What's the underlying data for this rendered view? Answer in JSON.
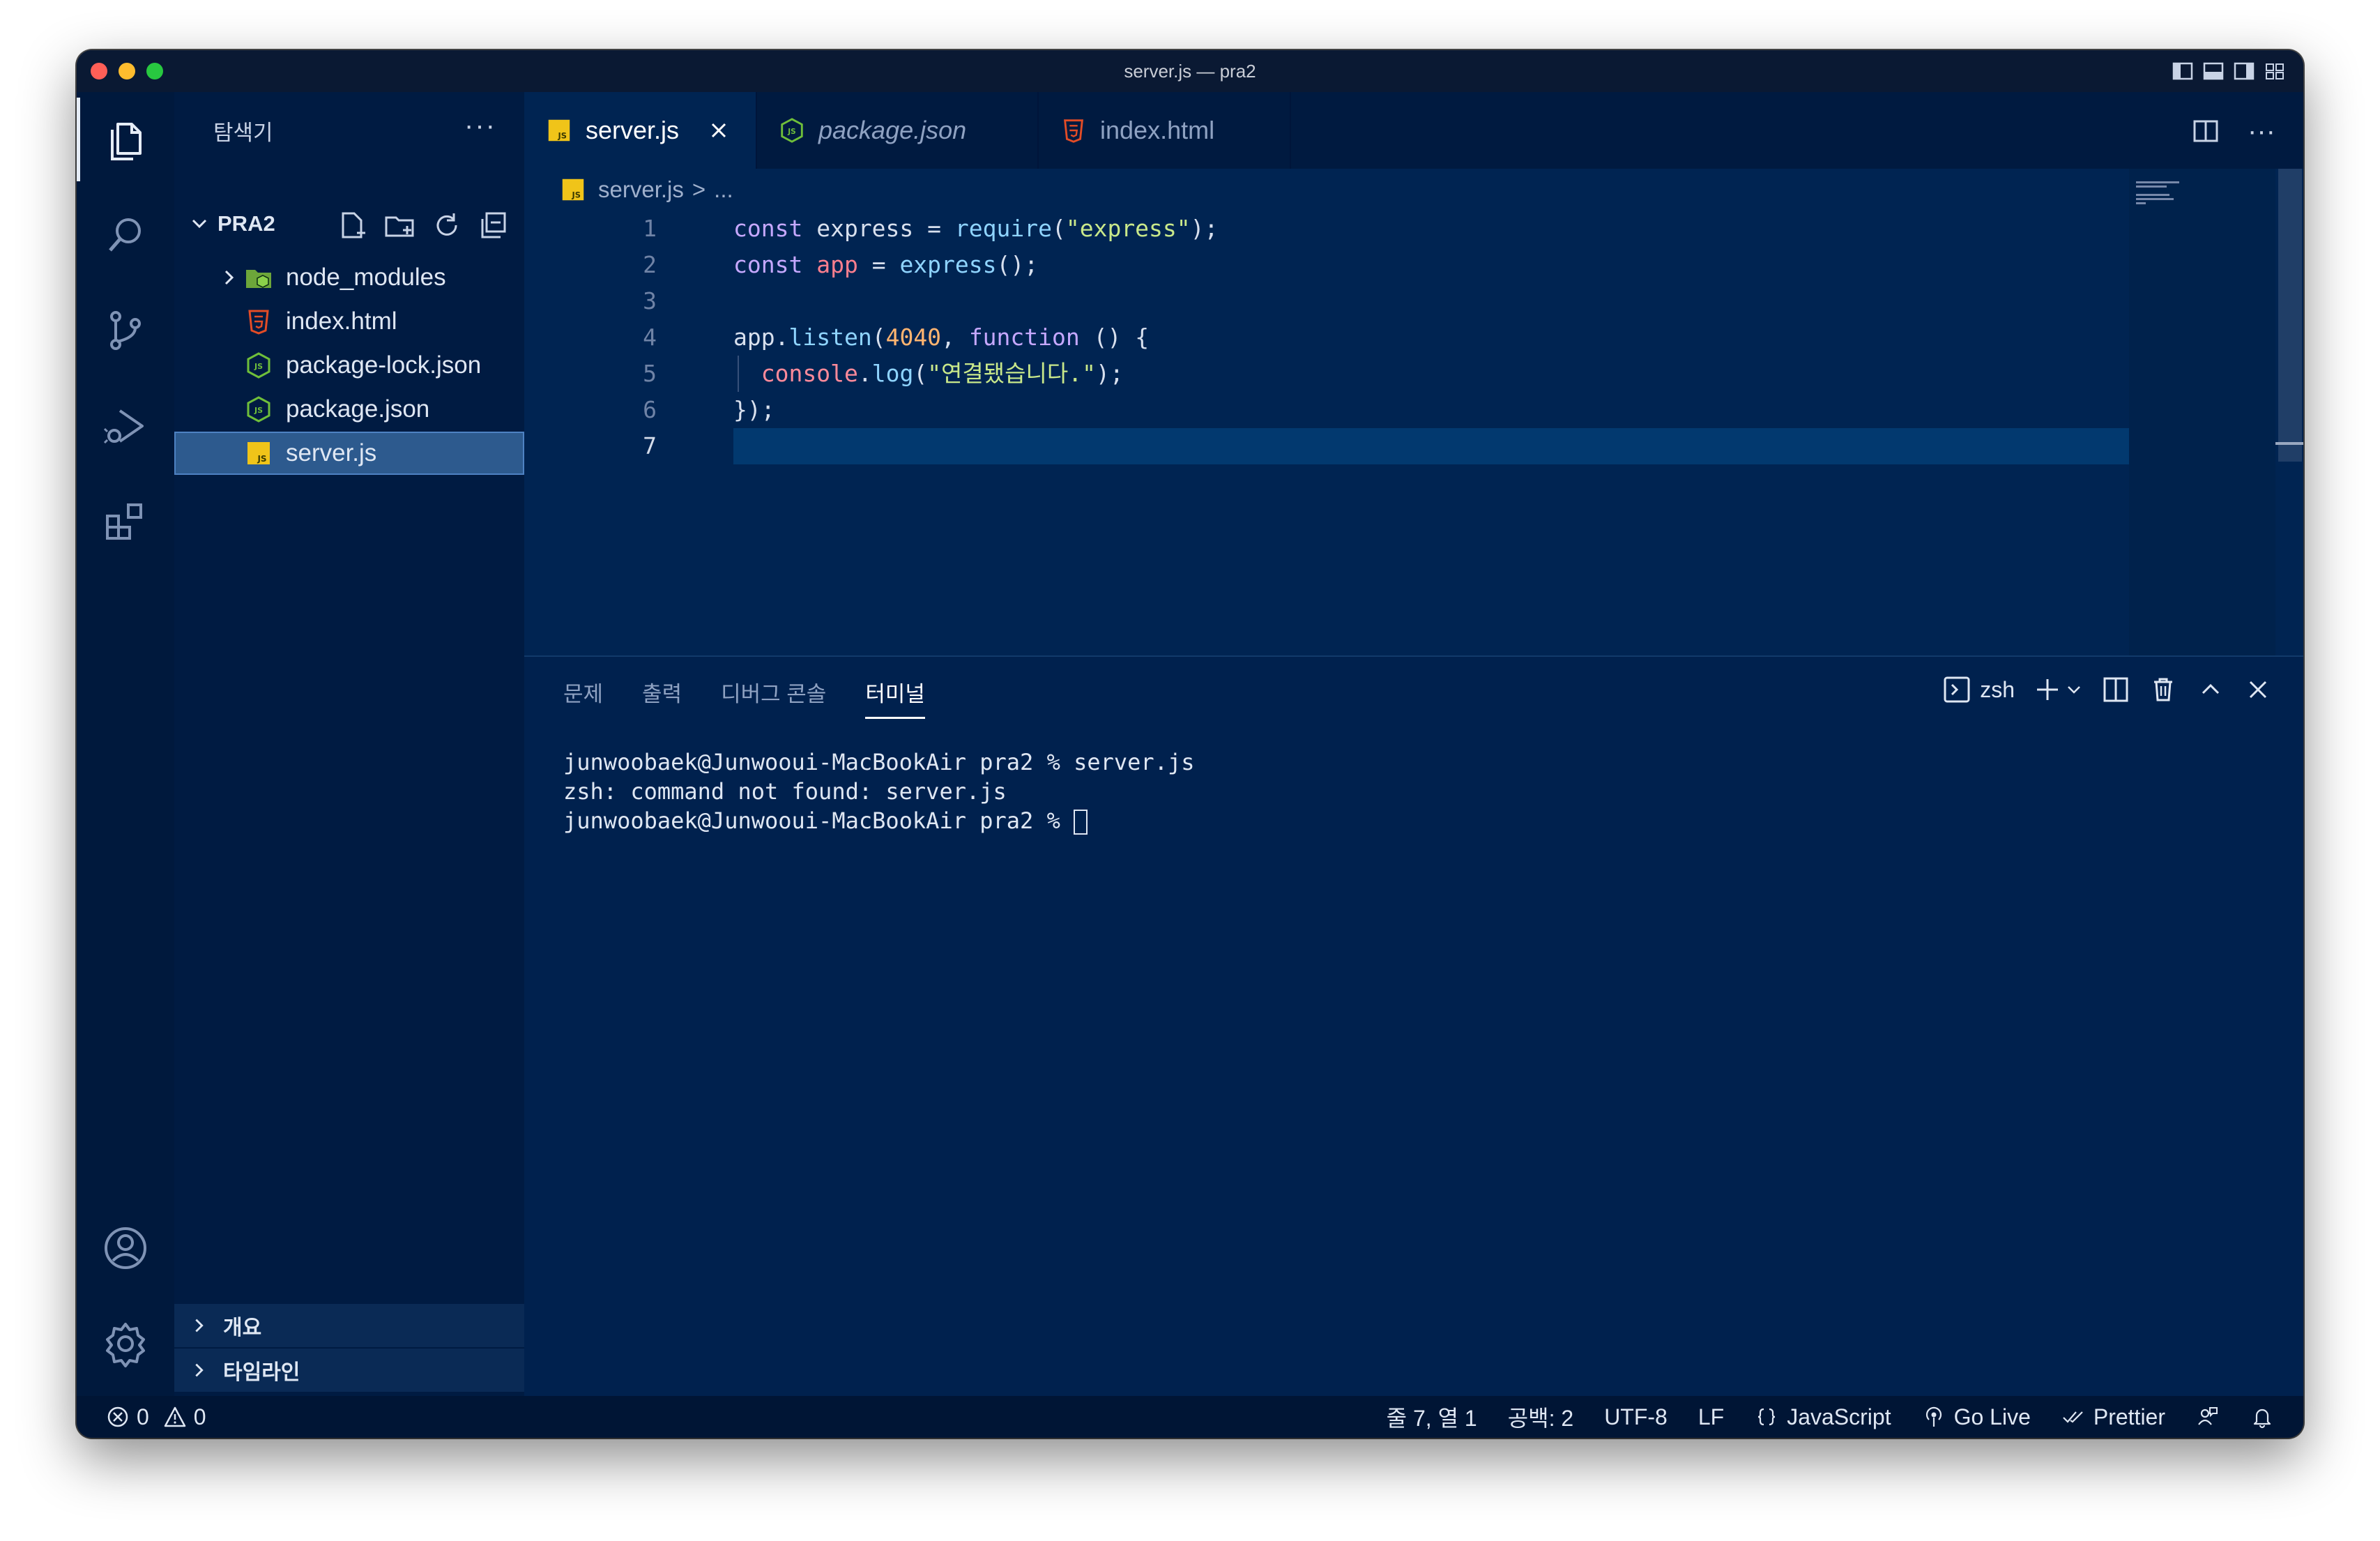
{
  "window": {
    "title": "server.js — pra2"
  },
  "sidebar": {
    "header": "탐색기",
    "more": "···",
    "folder": "PRA2",
    "files": [
      {
        "name": "node_modules",
        "type": "folder"
      },
      {
        "name": "index.html",
        "type": "html"
      },
      {
        "name": "package-lock.json",
        "type": "json"
      },
      {
        "name": "package.json",
        "type": "json"
      },
      {
        "name": "server.js",
        "type": "js",
        "selected": true
      }
    ],
    "outline": "개요",
    "timeline": "타임라인"
  },
  "tabs": [
    {
      "label": "server.js",
      "active": true
    },
    {
      "label": "package.json",
      "italic": true
    },
    {
      "label": "index.html"
    }
  ],
  "breadcrumb": {
    "file": "server.js",
    "sep": ">",
    "rest": "..."
  },
  "editor": {
    "line_numbers": [
      "1",
      "2",
      "3",
      "4",
      "5",
      "6",
      "7"
    ],
    "current_line": 7,
    "lines": [
      [
        [
          "kw",
          "const"
        ],
        [
          "var",
          " express = "
        ],
        [
          "fn",
          "require"
        ],
        [
          "var",
          "("
        ],
        [
          "str",
          "\"express\""
        ],
        [
          "var",
          ");"
        ]
      ],
      [
        [
          "kw",
          "const"
        ],
        [
          "var",
          " "
        ],
        [
          "vapp",
          "app"
        ],
        [
          "var",
          " = "
        ],
        [
          "fn",
          "express"
        ],
        [
          "var",
          "();"
        ]
      ],
      [],
      [
        [
          "var",
          "app."
        ],
        [
          "fn",
          "listen"
        ],
        [
          "var",
          "("
        ],
        [
          "num",
          "4040"
        ],
        [
          "var",
          ", "
        ],
        [
          "kw",
          "function"
        ],
        [
          "var",
          " () {"
        ]
      ],
      [
        [
          "var",
          "  "
        ],
        [
          "obj",
          "console"
        ],
        [
          "var",
          "."
        ],
        [
          "fn",
          "log"
        ],
        [
          "var",
          "("
        ],
        [
          "str",
          "\"연결됐습니다.\""
        ],
        [
          "var",
          ");"
        ]
      ],
      [
        [
          "var",
          "});"
        ]
      ],
      []
    ]
  },
  "panel": {
    "tabs": [
      "문제",
      "출력",
      "디버그 콘솔",
      "터미널"
    ],
    "active_tab": "터미널",
    "shell": "zsh",
    "terminal_lines": [
      "junwoobaek@Junwooui-MacBookAir pra2 % server.js",
      "zsh: command not found: server.js",
      "junwoobaek@Junwooui-MacBookAir pra2 % "
    ]
  },
  "statusbar": {
    "errors": "0",
    "warnings": "0",
    "position": "줄 7, 열 1",
    "spaces": "공백: 2",
    "encoding": "UTF-8",
    "eol": "LF",
    "language": "JavaScript",
    "golive": "Go Live",
    "prettier": "Prettier"
  },
  "colors": {
    "editor_bg": "#002452",
    "sidebar_bg": "#001b42",
    "activity_bg": "#00193d",
    "selection": "#2d5a8e"
  }
}
